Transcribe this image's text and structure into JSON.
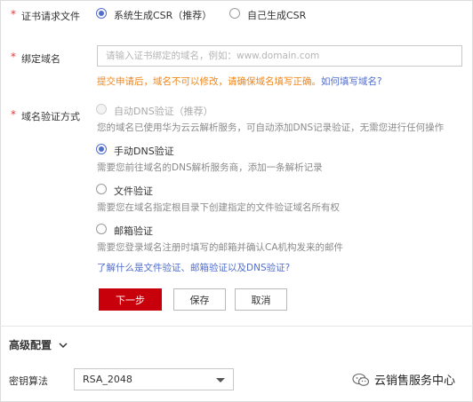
{
  "cert_request": {
    "label": "证书请求文件",
    "option_system": "系统生成CSR（推荐）",
    "option_self": "自己生成CSR"
  },
  "domain": {
    "label": "绑定域名",
    "placeholder": "请输入证书绑定的域名，例如：www.domain.com",
    "warning": "提交申请后，域名不可以修改，请确保域名填写正确。",
    "help_link": "如何填写域名?"
  },
  "verify": {
    "label": "域名验证方式",
    "options": [
      {
        "label": "自动DNS验证（推荐）",
        "desc": "您的域名已使用华为云云解析服务，可自动添加DNS记录验证，无需您进行任何操作"
      },
      {
        "label": "手动DNS验证",
        "desc": "需要您前往域名的DNS解析服务商，添加一条解析记录"
      },
      {
        "label": "文件验证",
        "desc": "需要您在域名指定根目录下创建指定的文件验证域名所有权"
      },
      {
        "label": "邮箱验证",
        "desc": "需要您登录域名注册时填写的邮箱并确认CA机构发来的邮件"
      }
    ],
    "learn_link": "了解什么是文件验证、邮箱验证以及DNS验证?"
  },
  "actions": {
    "next": "下一步",
    "save": "保存",
    "cancel": "取消"
  },
  "advanced": {
    "title": "高级配置",
    "key_algo_label": "密钥算法",
    "key_algo_value": "RSA_2048"
  },
  "watermark": {
    "text": "云销售服务中心"
  },
  "colors": {
    "primary_button": "#c7000b",
    "link": "#526ecc",
    "warning": "#f0861a",
    "required": "#e4393c"
  }
}
